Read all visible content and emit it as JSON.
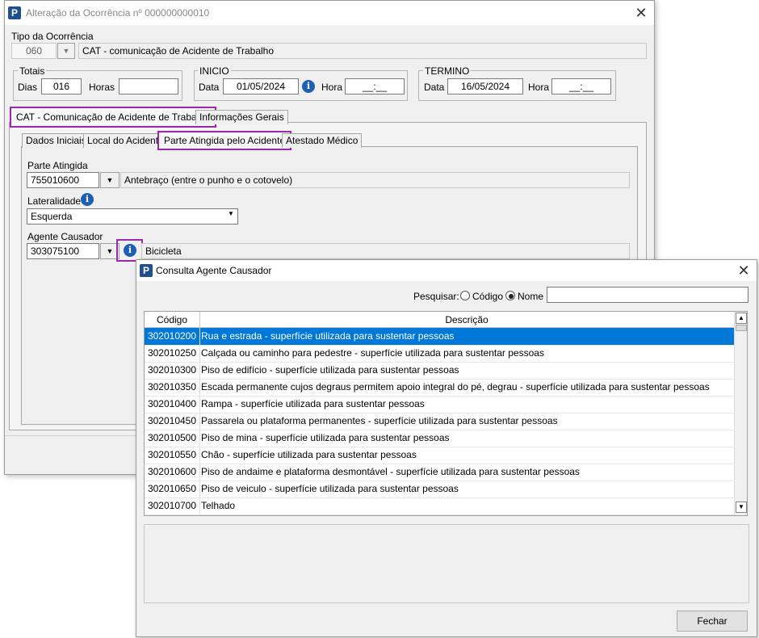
{
  "main_window": {
    "title": "Alteração da Ocorrência nº 000000000010",
    "tipo_label": "Tipo da Ocorrência",
    "tipo_code": "060",
    "tipo_desc": "CAT - comunicação de Acidente de Trabalho",
    "totais": {
      "legend": "Totais",
      "dias_label": "Dias",
      "dias_value": "016",
      "horas_label": "Horas",
      "horas_value": ""
    },
    "inicio": {
      "legend": "INICIO",
      "data_label": "Data",
      "data_value": "01/05/2024",
      "hora_label": "Hora",
      "hora_value": "__:__"
    },
    "termino": {
      "legend": "TERMINO",
      "data_label": "Data",
      "data_value": "16/05/2024",
      "hora_label": "Hora",
      "hora_value": "__:__"
    },
    "outer_tabs": [
      "CAT - Comunicação de Acidente de Trabalho",
      "Informações Gerais"
    ],
    "inner_tabs": [
      "Dados Iniciais",
      "Local do Acidente",
      "Parte Atingida pelo Acidente",
      "Atestado Médico"
    ],
    "parte": {
      "label": "Parte Atingida",
      "code": "755010600",
      "desc": "Antebraço (entre o punho e o cotovelo)"
    },
    "lateralidade": {
      "label": "Lateralidade",
      "value": "Esquerda"
    },
    "agente": {
      "label": "Agente Causador",
      "code": "303075100",
      "desc": "Bicicleta"
    }
  },
  "dialog": {
    "title": "Consulta Agente Causador",
    "search_label": "Pesquisar:",
    "option_codigo": "Código",
    "option_nome": "Nome",
    "search_value": "",
    "col_codigo": "Código",
    "col_descricao": "Descrição",
    "rows": [
      {
        "code": "302010200",
        "desc": "Rua e estrada - superfície utilizada para sustentar pessoas"
      },
      {
        "code": "302010250",
        "desc": "Calçada ou caminho para pedestre - superfície utilizada para sustentar pessoas"
      },
      {
        "code": "302010300",
        "desc": "Piso de edifício - superfície utilizada para sustentar pessoas"
      },
      {
        "code": "302010350",
        "desc": "Escada permanente cujos degraus permitem apoio integral do pé, degrau - superfície utilizada para sustentar pessoas"
      },
      {
        "code": "302010400",
        "desc": "Rampa - superfície utilizada para sustentar pessoas"
      },
      {
        "code": "302010450",
        "desc": "Passarela ou plataforma permanentes - superfície utilizada para sustentar pessoas"
      },
      {
        "code": "302010500",
        "desc": "Piso de mina - superfície utilizada para sustentar pessoas"
      },
      {
        "code": "302010550",
        "desc": "Chão - superfície utilizada para sustentar pessoas"
      },
      {
        "code": "302010600",
        "desc": "Piso de andaime e plataforma desmontável - superfície utilizada para sustentar pessoas"
      },
      {
        "code": "302010650",
        "desc": "Piso de veiculo - superfície utilizada para sustentar pessoas"
      },
      {
        "code": "302010700",
        "desc": "Telhado"
      }
    ],
    "close_button": "Fechar"
  },
  "colors": {
    "selection": "#0078d7",
    "highlight": "#9c27b0",
    "brand": "#1f4f8f"
  }
}
